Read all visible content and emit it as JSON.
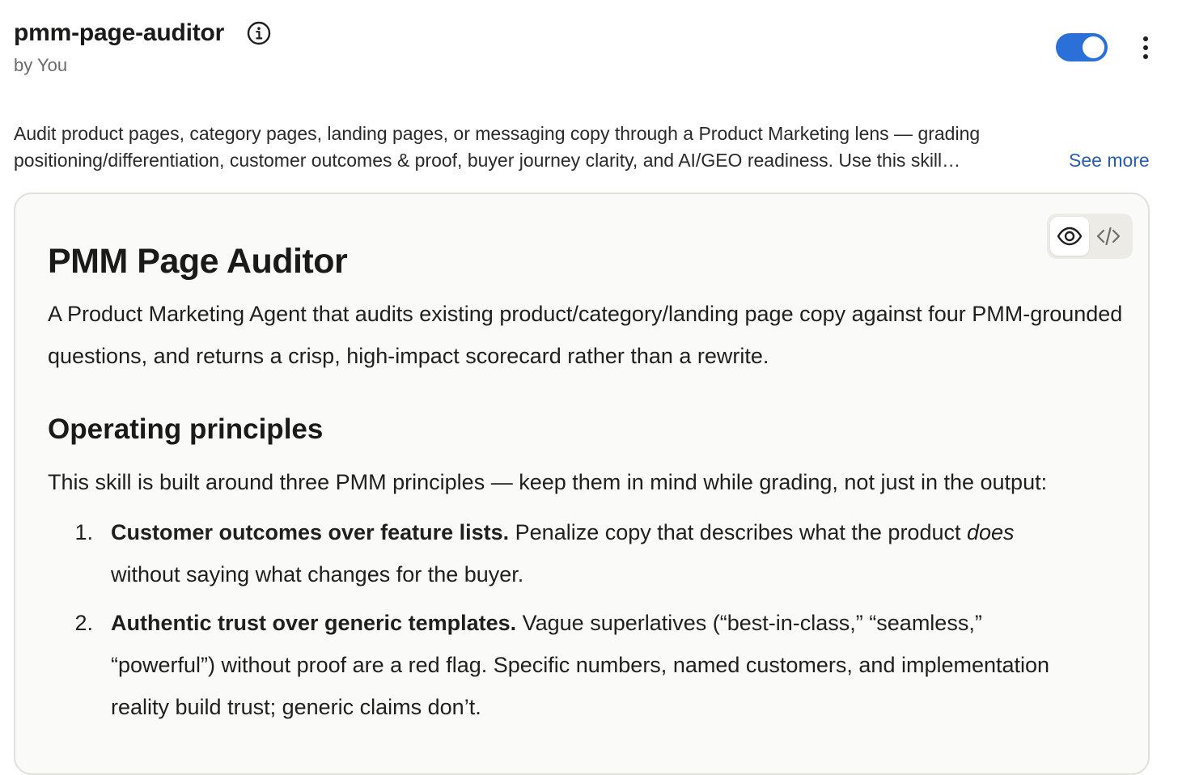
{
  "header": {
    "title": "pmm-page-auditor",
    "byline": "by You",
    "enabled": true
  },
  "description": {
    "text": "Audit product pages, category pages, landing pages, or messaging copy through a Product Marketing lens — grading positioning/differentiation, customer outcomes & proof, buyer journey clarity, and AI/GEO readiness. Use this skill…",
    "see_more_label": "See more"
  },
  "view_switch": {
    "active": "preview",
    "options": [
      "preview",
      "code"
    ]
  },
  "document": {
    "h1": "PMM Page Auditor",
    "intro": "A Product Marketing Agent that audits existing product/category/landing page copy against four PMM-grounded questions, and returns a crisp, high-impact scorecard rather than a rewrite.",
    "h2": "Operating principles",
    "lead": "This skill is built around three PMM principles — keep them in mind while grading, not just in the output:",
    "principles": [
      {
        "num": "1.",
        "bold": "Customer outcomes over feature lists.",
        "text_before_italic": " Penalize copy that describes what the product ",
        "italic": "does",
        "text_after_italic": " without saying what changes for the buyer."
      },
      {
        "num": "2.",
        "bold": "Authentic trust over generic templates.",
        "text_before_italic": " Vague superlatives (“best-in-class,” “seamless,” “powerful”) without proof are a red flag. Specific numbers, named customers, and implementation reality build trust; generic claims don’t.",
        "italic": "",
        "text_after_italic": ""
      }
    ]
  },
  "colors": {
    "toggle_on": "#2b6fd8",
    "link": "#2a5bb0",
    "card_bg": "#fafaf8",
    "card_border": "#e1e0da"
  }
}
